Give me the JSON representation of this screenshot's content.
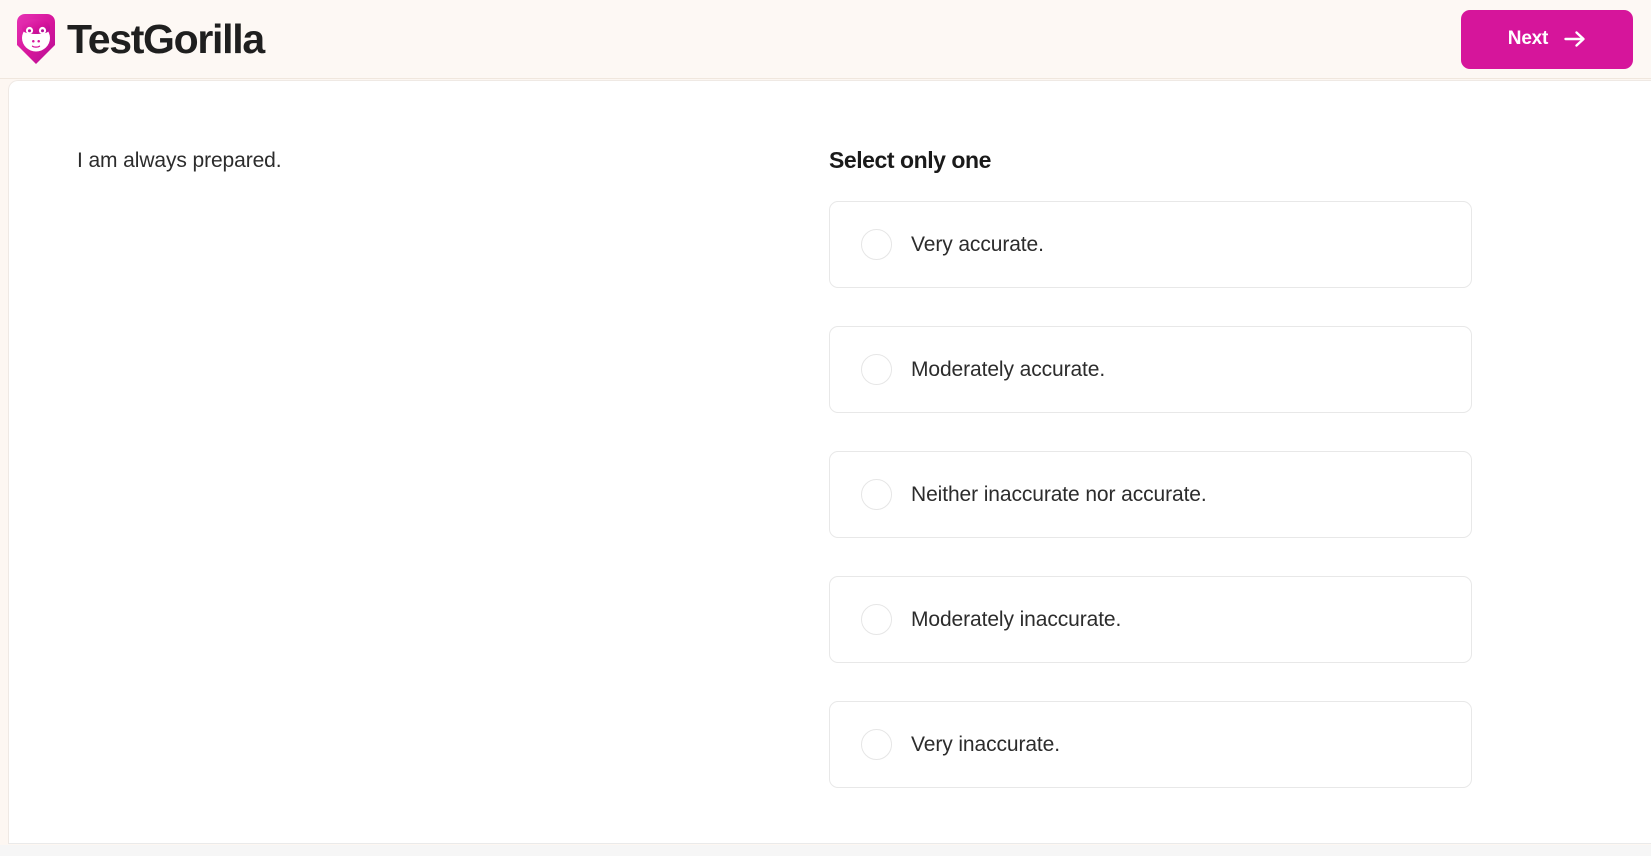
{
  "header": {
    "brand": {
      "name": "TestGorilla",
      "logo_icon": "gorilla-logo-icon",
      "logo_color": "#D6159B"
    },
    "next_button": {
      "label": "Next",
      "icon": "arrow-right-icon",
      "color": "#D6159B",
      "text_color": "#FFFFFF"
    },
    "background_color": "#FDF8F4"
  },
  "question": {
    "text": "I am always prepared."
  },
  "answers": {
    "heading": "Select only one",
    "selected_index": null,
    "options": [
      {
        "label": "Very accurate.",
        "selected": false
      },
      {
        "label": "Moderately accurate.",
        "selected": false
      },
      {
        "label": "Neither inaccurate nor accurate.",
        "selected": false
      },
      {
        "label": "Moderately inaccurate.",
        "selected": false
      },
      {
        "label": "Very inaccurate.",
        "selected": false
      }
    ]
  }
}
